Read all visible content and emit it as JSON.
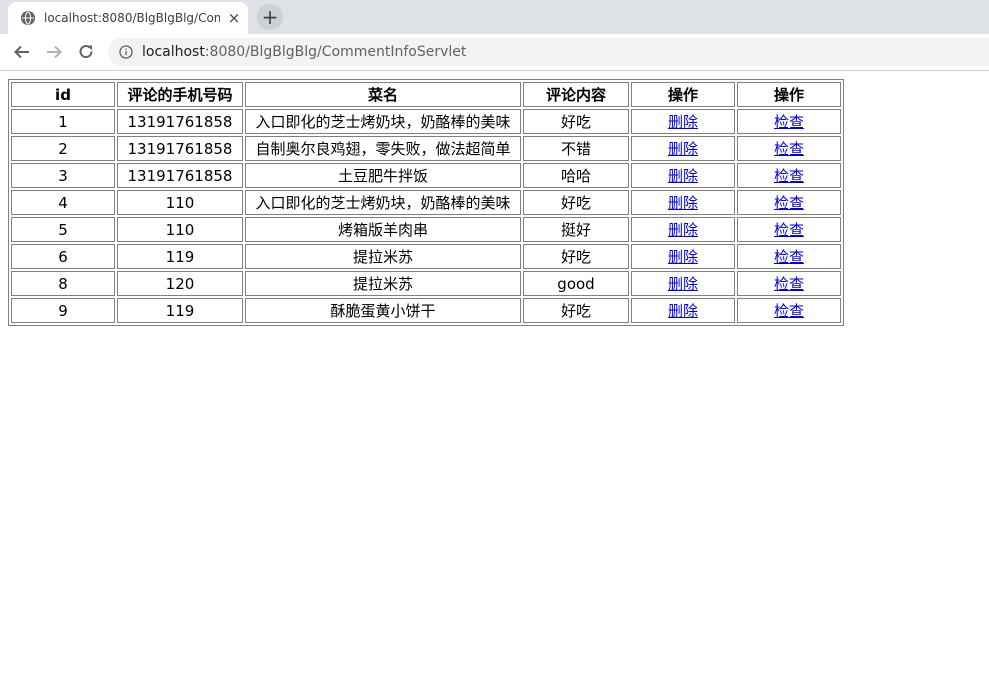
{
  "browser": {
    "tab_title": "localhost:8080/BlgBlgBlg/Com",
    "tab_close": "×",
    "new_tab": "+",
    "url_host": "localhost",
    "url_rest": ":8080/BlgBlgBlg/CommentInfoServlet"
  },
  "table": {
    "headers": [
      "id",
      "评论的手机号码",
      "菜名",
      "评论内容",
      "操作",
      "操作"
    ],
    "delete_label": "删除",
    "check_label": "检查",
    "rows": [
      {
        "id": "1",
        "phone": "13191761858",
        "dish": "入口即化的芝士烤奶块，奶酪棒的美味",
        "content": "好吃"
      },
      {
        "id": "2",
        "phone": "13191761858",
        "dish": "自制奥尔良鸡翅，零失败，做法超简单",
        "content": "不错"
      },
      {
        "id": "3",
        "phone": "13191761858",
        "dish": "土豆肥牛拌饭",
        "content": "哈哈"
      },
      {
        "id": "4",
        "phone": "110",
        "dish": "入口即化的芝士烤奶块，奶酪棒的美味",
        "content": "好吃"
      },
      {
        "id": "5",
        "phone": "110",
        "dish": "烤箱版羊肉串",
        "content": "挺好"
      },
      {
        "id": "6",
        "phone": "119",
        "dish": "提拉米苏",
        "content": "好吃"
      },
      {
        "id": "8",
        "phone": "120",
        "dish": "提拉米苏",
        "content": "good"
      },
      {
        "id": "9",
        "phone": "119",
        "dish": "酥脆蛋黄小饼干",
        "content": "好吃"
      }
    ]
  },
  "colors": {
    "link": "#0000ee",
    "tabstrip": "#dee1e6",
    "omnibox": "#f1f3f4"
  }
}
